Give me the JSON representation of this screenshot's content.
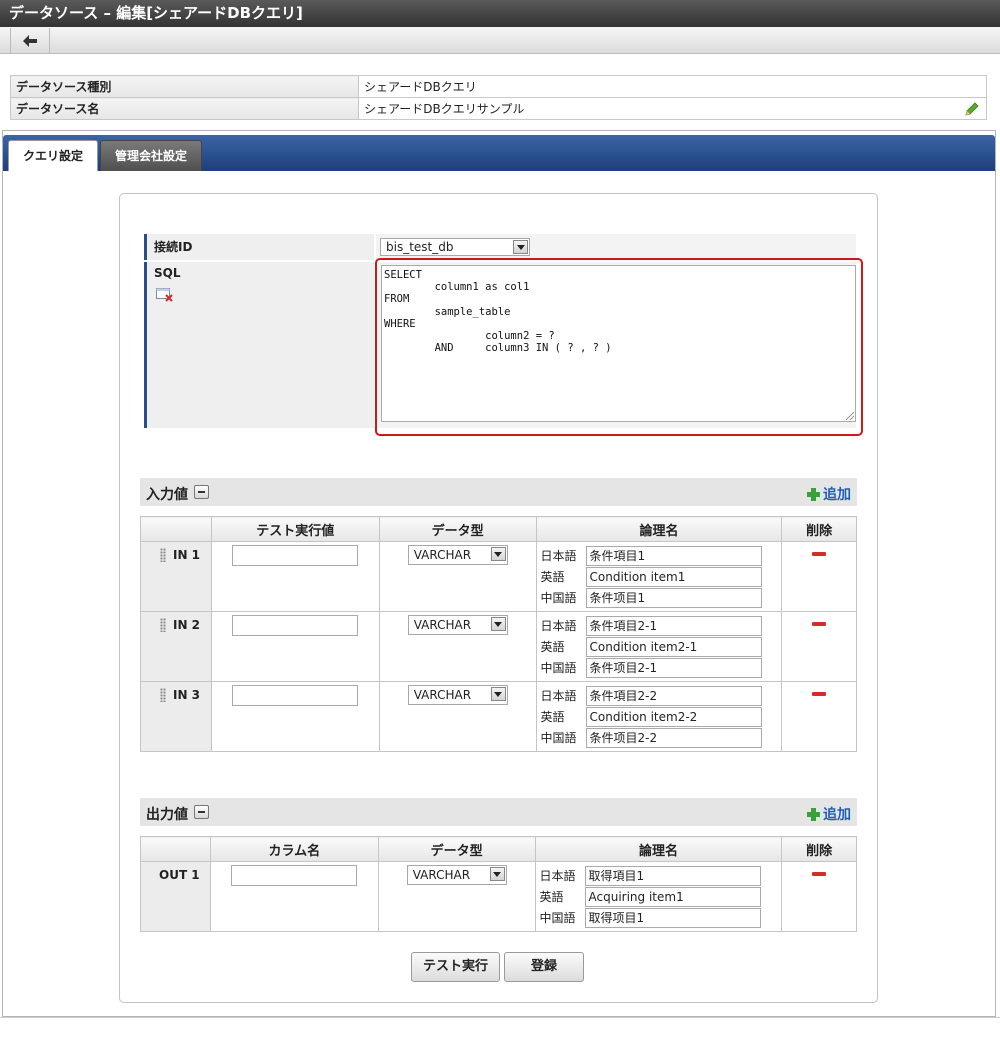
{
  "window": {
    "title": "データソース – 編集[シェアードDBクエリ]"
  },
  "toolbar": {
    "back_icon": "back-arrow-icon"
  },
  "info": {
    "rows": [
      {
        "label": "データソース種別",
        "value": "シェアードDBクエリ"
      },
      {
        "label": "データソース名",
        "value": "シェアードDBクエリサンプル"
      }
    ]
  },
  "tabs": [
    {
      "label": "クエリ設定",
      "active": true
    },
    {
      "label": "管理会社設定",
      "active": false
    }
  ],
  "connection": {
    "label": "接続ID",
    "value": "bis_test_db"
  },
  "sql": {
    "label": "SQL",
    "text": "SELECT\n        column1 as col1\nFROM\n        sample_table\nWHERE\n                column2 = ?\n        AND     column3 IN ( ? , ? )"
  },
  "input_section": {
    "title": "入力値",
    "add_label": "追加",
    "headers": [
      "",
      "テスト実行値",
      "データ型",
      "論理名",
      "削除"
    ],
    "rows": [
      {
        "name": "IN 1",
        "test_value": "",
        "type": "VARCHAR",
        "logical": [
          {
            "lang": "日本語",
            "value": "条件項目1"
          },
          {
            "lang": "英語",
            "value": "Condition item1"
          },
          {
            "lang": "中国語",
            "value": "条件项目1"
          }
        ]
      },
      {
        "name": "IN 2",
        "test_value": "",
        "type": "VARCHAR",
        "logical": [
          {
            "lang": "日本語",
            "value": "条件項目2-1"
          },
          {
            "lang": "英語",
            "value": "Condition item2-1"
          },
          {
            "lang": "中国語",
            "value": "条件项目2-1"
          }
        ]
      },
      {
        "name": "IN 3",
        "test_value": "",
        "type": "VARCHAR",
        "logical": [
          {
            "lang": "日本語",
            "value": "条件項目2-2"
          },
          {
            "lang": "英語",
            "value": "Condition item2-2"
          },
          {
            "lang": "中国語",
            "value": "条件项目2-2"
          }
        ]
      }
    ]
  },
  "output_section": {
    "title": "出力値",
    "add_label": "追加",
    "headers": [
      "",
      "カラム名",
      "データ型",
      "論理名",
      "削除"
    ],
    "rows": [
      {
        "name": "OUT 1",
        "column": "",
        "type": "VARCHAR",
        "logical": [
          {
            "lang": "日本語",
            "value": "取得項目1"
          },
          {
            "lang": "英語",
            "value": "Acquiring item1"
          },
          {
            "lang": "中国語",
            "value": "取得项目1"
          }
        ]
      }
    ]
  },
  "buttons": {
    "test_run": "テスト実行",
    "register": "登録"
  },
  "colors": {
    "tab_bar": "#2c4d8c",
    "highlight": "#d01818",
    "add_green": "#3aa03a",
    "delete_red": "#d42c2c"
  }
}
